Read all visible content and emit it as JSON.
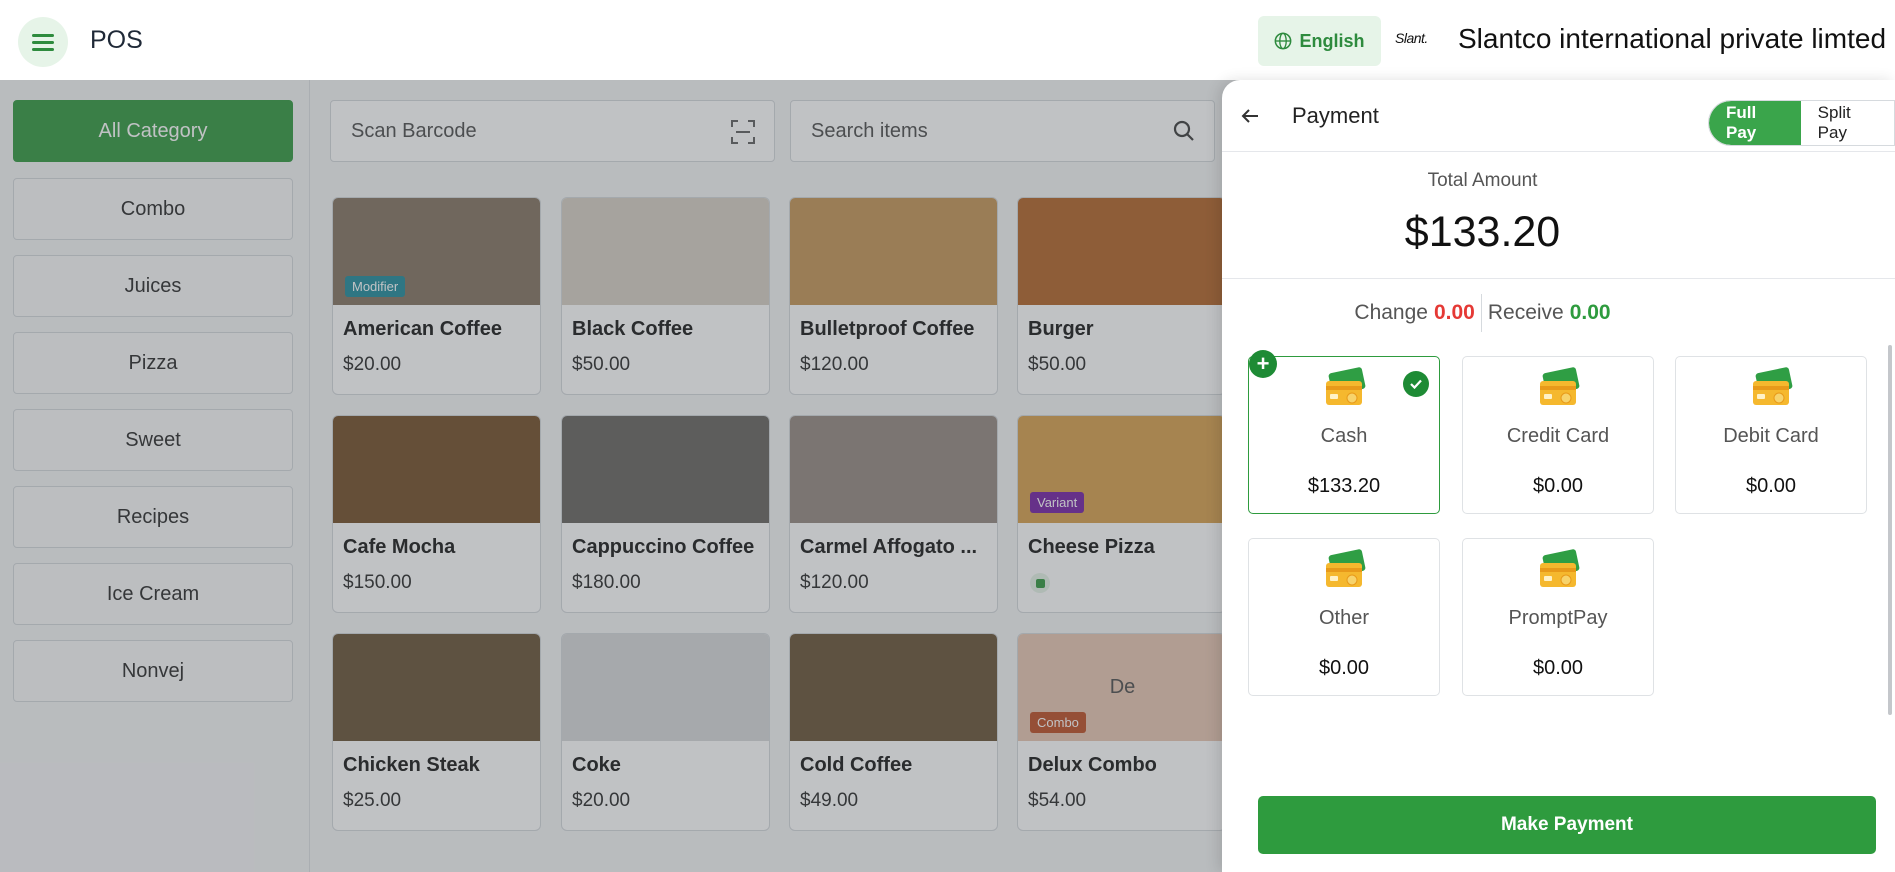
{
  "header": {
    "app_title": "POS",
    "language": "English",
    "brand_logo_text": "Slant.",
    "company_name": "Slantco international private limted"
  },
  "sidebar": {
    "categories": [
      {
        "label": "All Category",
        "active": true
      },
      {
        "label": "Combo"
      },
      {
        "label": "Juices"
      },
      {
        "label": "Pizza"
      },
      {
        "label": "Sweet"
      },
      {
        "label": "Recipes"
      },
      {
        "label": "Ice Cream"
      },
      {
        "label": "Nonvej"
      }
    ]
  },
  "search": {
    "barcode_placeholder": "Scan Barcode",
    "items_placeholder": "Search items"
  },
  "products": [
    {
      "name": "American Coffee",
      "price": "$20.00",
      "badge": "Modifier",
      "color": "#8a7a68"
    },
    {
      "name": "Black Coffee",
      "price": "$50.00",
      "color": "#d9d2c8"
    },
    {
      "name": "Bulletproof Coffee",
      "price": "$120.00",
      "color": "#c89a5e"
    },
    {
      "name": "Burger",
      "price": "$50.00",
      "color": "#b56a32"
    },
    {
      "name": "Cafe Mocha",
      "price": "$150.00",
      "color": "#7a5632"
    },
    {
      "name": "Cappuccino Coffee",
      "price": "$180.00",
      "color": "#6e6a66"
    },
    {
      "name": "Carmel Affogato ...",
      "price": "$120.00",
      "color": "#9a8e86"
    },
    {
      "name": "Cheese Pizza",
      "price": "",
      "badge": "Variant",
      "color": "#d9a454"
    },
    {
      "name": "Chicken Steak",
      "price": "$25.00",
      "color": "#6f5a3e"
    },
    {
      "name": "Coke",
      "price": "$20.00",
      "color": "#d9dadc"
    },
    {
      "name": "Cold Coffee",
      "price": "$49.00",
      "color": "#6f5a3e"
    },
    {
      "name": "Delux Combo",
      "price": "$54.00",
      "badge": "Combo",
      "placeholder": "De",
      "color": "#e9c9b6"
    }
  ],
  "payment": {
    "title": "Payment",
    "full_pay": "Full Pay",
    "split_pay": "Split Pay",
    "total_label": "Total Amount",
    "total_value": "$133.20",
    "change_label": "Change",
    "change_value": "0.00",
    "receive_label": "Receive",
    "receive_value": "0.00",
    "methods": [
      {
        "name": "Cash",
        "amount": "$133.20",
        "selected": true
      },
      {
        "name": "Credit Card",
        "amount": "$0.00"
      },
      {
        "name": "Debit Card",
        "amount": "$0.00"
      },
      {
        "name": "Other",
        "amount": "$0.00"
      },
      {
        "name": "PromptPay",
        "amount": "$0.00"
      }
    ],
    "make_payment": "Make Payment"
  },
  "colors": {
    "accent": "#2e9b3e",
    "change": "#e53935",
    "receive": "#2e9b3e"
  }
}
